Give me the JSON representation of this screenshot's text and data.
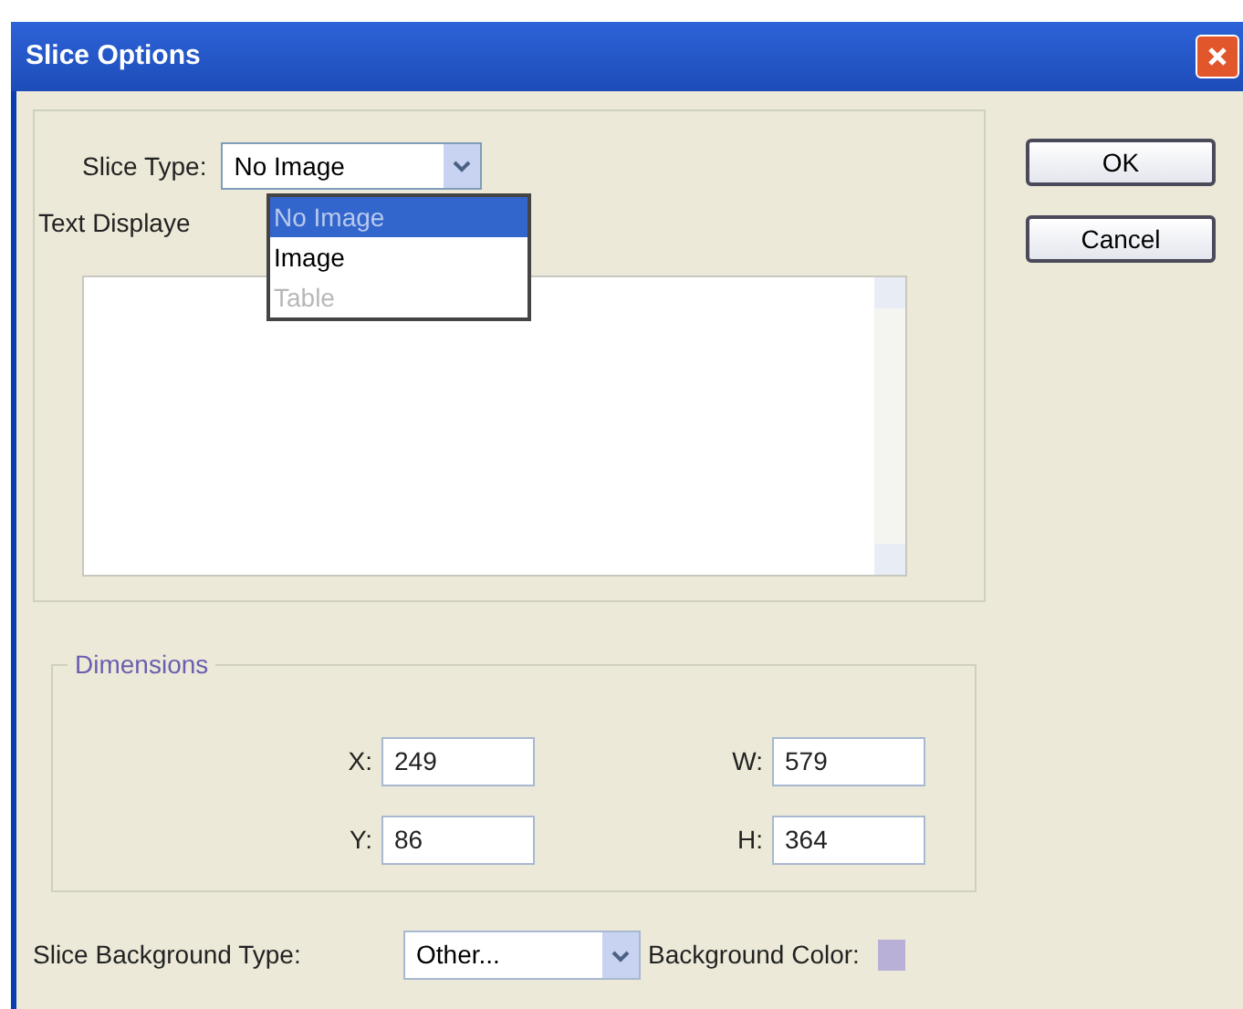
{
  "window": {
    "title": "Slice Options"
  },
  "slice_type": {
    "label": "Slice Type:",
    "value": "No Image",
    "options": [
      {
        "label": "No Image",
        "selected": true,
        "disabled": false
      },
      {
        "label": "Image",
        "selected": false,
        "disabled": false
      },
      {
        "label": "Table",
        "selected": false,
        "disabled": true
      }
    ]
  },
  "text_displayed": {
    "label": "Text Displaye"
  },
  "buttons": [
    "OK",
    "Cancel"
  ],
  "dimensions": {
    "title": "Dimensions",
    "fields": [
      {
        "label": "X:",
        "value": "249"
      },
      {
        "label": "W:",
        "value": "579"
      },
      {
        "label": "Y:",
        "value": "86"
      },
      {
        "label": "H:",
        "value": "364"
      }
    ]
  },
  "background_type": {
    "label": "Slice Background Type:",
    "value": "Other..."
  },
  "background_color": {
    "label": "Background Color:",
    "color": "#b8b0d6"
  }
}
